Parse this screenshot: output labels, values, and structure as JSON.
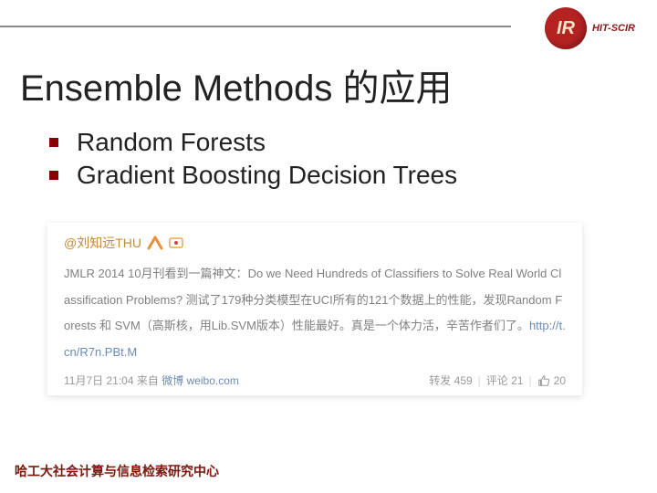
{
  "logo": {
    "mark": "IR",
    "text": "HIT-SCIR"
  },
  "slide": {
    "title": "Ensemble Methods 的应用",
    "bullets": [
      "Random Forests",
      "Gradient Boosting Decision Trees"
    ]
  },
  "weibo": {
    "user_prefix": "@",
    "user_name": "刘知远THU",
    "body_prefix": "JMLR 2014 10月刊看到一篇神文：",
    "body_title": "Do we Need Hundreds of Classifiers to Solve Real World Classification Problems?",
    "body_rest": " 测试了179种分类模型在UCI所有的121个数据上的性能，发现Random Forests 和 SVM（高斯核，用Lib.SVM版本）性能最好。真是一个体力活，辛苦作者们了。",
    "link": "http://t.cn/R7n.PBt.M",
    "meta": {
      "time": "11月7日 21:04",
      "via_prefix": "来自",
      "via_source": "微博 weibo.com",
      "repost_label": "转发",
      "repost_count": "459",
      "comment_label": "评论",
      "comment_count": "21",
      "like_count": "20"
    }
  },
  "footer": "哈工大社会计算与信息检索研究中心"
}
